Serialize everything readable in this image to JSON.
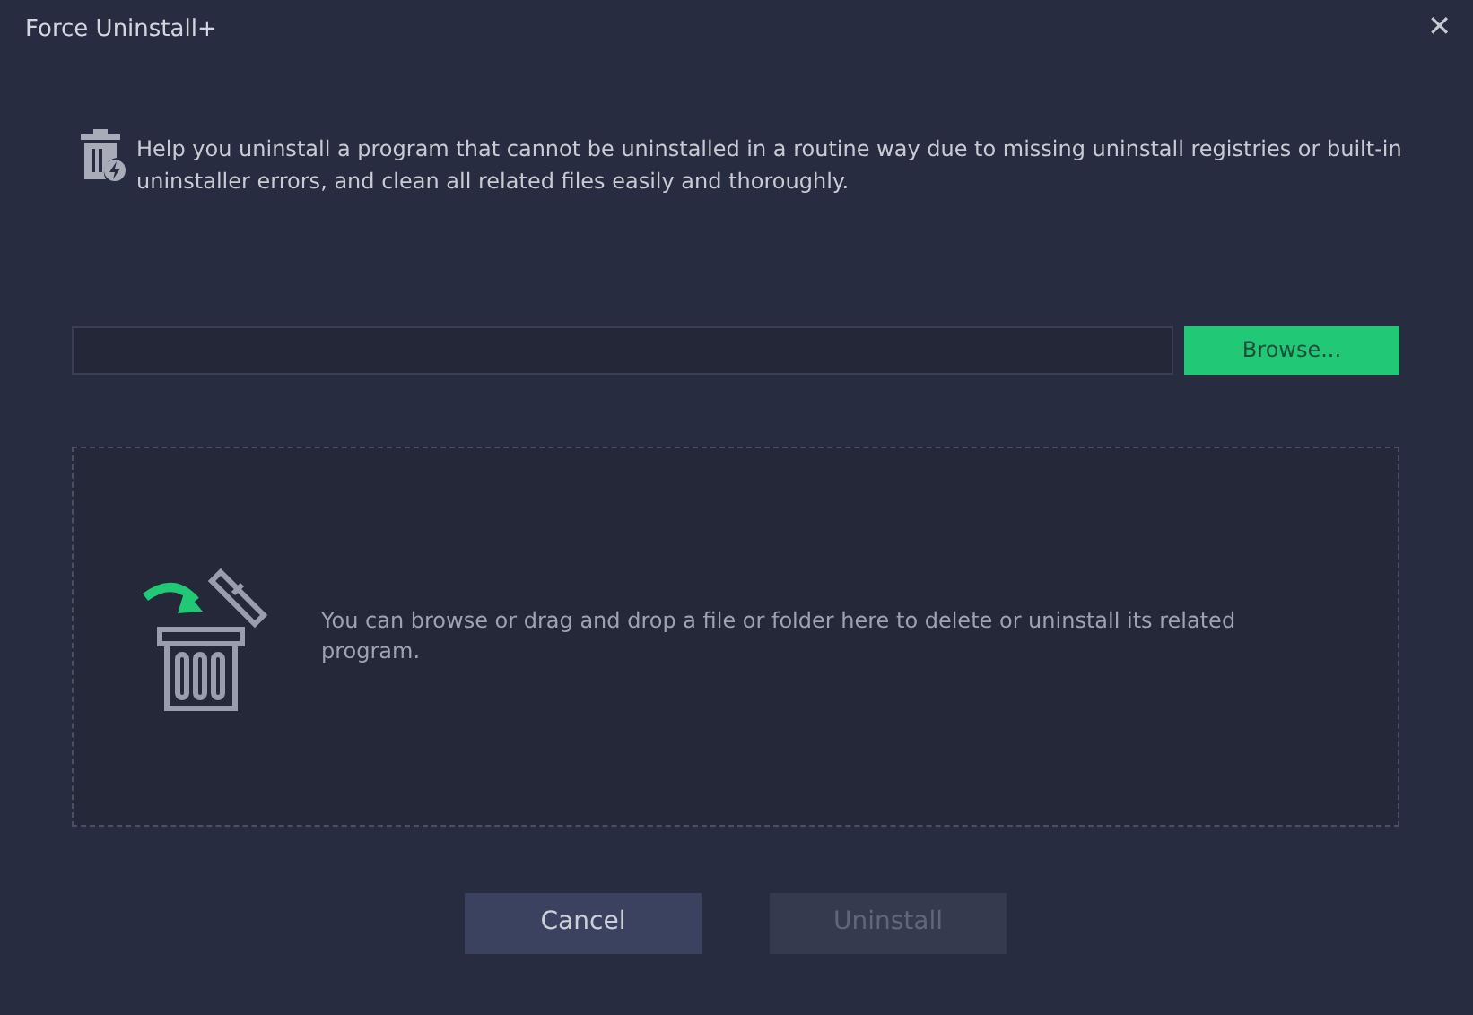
{
  "window": {
    "title": "Force Uninstall+",
    "close": "✕"
  },
  "description": "Help you uninstall a program that cannot be uninstalled in a routine way due to missing uninstall registries or built-in uninstaller errors, and clean all related files easily and thoroughly.",
  "path_field": {
    "browse_button": "Browse..."
  },
  "drop_zone": {
    "text": "You can browse or drag and drop a file or folder here to delete or uninstall its related program."
  },
  "buttons": [
    {
      "label": "Cancel",
      "disabled": false
    },
    {
      "label": "Uninstall",
      "disabled": true
    }
  ]
}
